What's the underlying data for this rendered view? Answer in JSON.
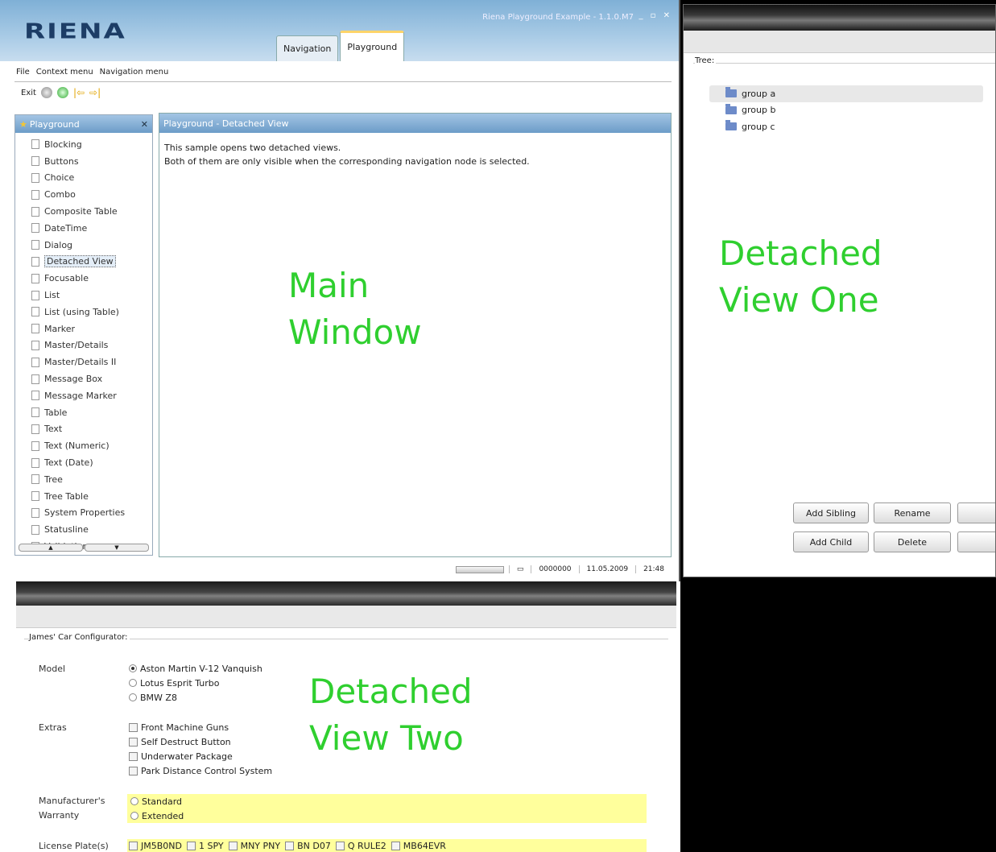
{
  "main_window": {
    "title": "Riena Playground Example - 1.1.0.M7",
    "logo": "RIENA",
    "tabs": [
      {
        "label": "Navigation"
      },
      {
        "label": "Playground"
      }
    ],
    "menu": [
      "File",
      "Context menu",
      "Navigation menu"
    ],
    "toolbar": {
      "exit_label": "Exit"
    },
    "nav_panel": {
      "title": "Playground",
      "items": [
        "Blocking",
        "Buttons",
        "Choice",
        "Combo",
        "Composite Table",
        "DateTime",
        "Dialog",
        "Detached View",
        "Focusable",
        "List",
        "List (using Table)",
        "Marker",
        "Master/Details",
        "Master/Details II",
        "Message Box",
        "Message Marker",
        "Table",
        "Text",
        "Text (Numeric)",
        "Text (Date)",
        "Tree",
        "Tree Table",
        "System Properties",
        "Statusline",
        "Validation"
      ],
      "selected": "Detached View"
    },
    "content": {
      "title": "Playground - Detached View",
      "line1": "This sample opens two detached views.",
      "line2": "Both of them are only visible when the corresponding navigation node is selected."
    },
    "status": {
      "number": "0000000",
      "date": "11.05.2009",
      "time": "21:48"
    }
  },
  "view_one": {
    "tree_label": "Tree:",
    "tree_items": [
      "group a",
      "group b",
      "group c"
    ],
    "buttons": {
      "add_sibling": "Add Sibling",
      "rename": "Rename",
      "add_child": "Add Child",
      "delete": "Delete"
    }
  },
  "view_two": {
    "group_label": "James' Car Configurator:",
    "model_label": "Model",
    "models": [
      "Aston Martin V-12 Vanquish",
      "Lotus Esprit Turbo",
      "BMW Z8"
    ],
    "extras_label": "Extras",
    "extras": [
      "Front Machine Guns",
      "Self Destruct Button",
      "Underwater Package",
      "Park Distance Control System"
    ],
    "warranty_label_1": "Manufacturer's",
    "warranty_label_2": "Warranty",
    "warranties": [
      "Standard",
      "Extended"
    ],
    "plates_label": "License Plate(s)",
    "plates": [
      "JM5B0ND",
      "1 SPY",
      "MNY PNY",
      "BN D07",
      "Q RULE2",
      "MB64EVR"
    ]
  },
  "annotations": {
    "main": "Main\nWindow",
    "one": "Detached\nView One",
    "two": "Detached\nView Two"
  },
  "colors": {
    "annotation": "#2fcf2f",
    "header_blue": "#7fb0d6",
    "highlight_yellow": "#ffff9c"
  }
}
